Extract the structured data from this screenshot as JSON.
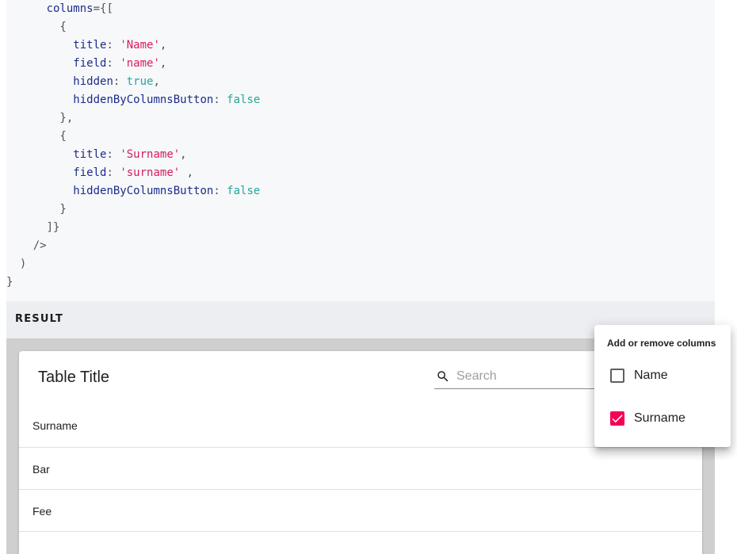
{
  "code": {
    "lines": [
      [
        {
          "t": "      "
        },
        {
          "t": "columns",
          "c": "prop"
        },
        {
          "t": "={[",
          "c": "punc"
        }
      ],
      [
        {
          "t": "        {",
          "c": "punc"
        }
      ],
      [
        {
          "t": "          "
        },
        {
          "t": "title",
          "c": "prop"
        },
        {
          "t": ": ",
          "c": "punc"
        },
        {
          "t": "'Name'",
          "c": "str"
        },
        {
          "t": ",",
          "c": "punc"
        }
      ],
      [
        {
          "t": "          "
        },
        {
          "t": "field",
          "c": "prop"
        },
        {
          "t": ": ",
          "c": "punc"
        },
        {
          "t": "'name'",
          "c": "str"
        },
        {
          "t": ",",
          "c": "punc"
        }
      ],
      [
        {
          "t": "          "
        },
        {
          "t": "hidden",
          "c": "prop"
        },
        {
          "t": ": ",
          "c": "punc"
        },
        {
          "t": "true",
          "c": "bool"
        },
        {
          "t": ",",
          "c": "punc"
        }
      ],
      [
        {
          "t": "          "
        },
        {
          "t": "hiddenByColumnsButton",
          "c": "prop"
        },
        {
          "t": ": ",
          "c": "punc"
        },
        {
          "t": "false",
          "c": "bool"
        }
      ],
      [
        {
          "t": "        },",
          "c": "punc"
        }
      ],
      [
        {
          "t": "        {",
          "c": "punc"
        }
      ],
      [
        {
          "t": "          "
        },
        {
          "t": "title",
          "c": "prop"
        },
        {
          "t": ": ",
          "c": "punc"
        },
        {
          "t": "'Surname'",
          "c": "str"
        },
        {
          "t": ",",
          "c": "punc"
        }
      ],
      [
        {
          "t": "          "
        },
        {
          "t": "field",
          "c": "prop"
        },
        {
          "t": ": ",
          "c": "punc"
        },
        {
          "t": "'surname'",
          "c": "str"
        },
        {
          "t": " ,",
          "c": "punc"
        }
      ],
      [
        {
          "t": "          "
        },
        {
          "t": "hiddenByColumnsButton",
          "c": "prop"
        },
        {
          "t": ": ",
          "c": "punc"
        },
        {
          "t": "false",
          "c": "bool"
        }
      ],
      [
        {
          "t": "        }",
          "c": "punc"
        }
      ],
      [
        {
          "t": "      ]}",
          "c": "punc"
        }
      ],
      [
        {
          "t": "    />",
          "c": "punc"
        }
      ],
      [
        {
          "t": "  )",
          "c": "punc"
        }
      ],
      [
        {
          "t": "}",
          "c": "punc"
        }
      ]
    ]
  },
  "result": {
    "label": "RESULT"
  },
  "table": {
    "title": "Table Title",
    "search": {
      "placeholder": "Search",
      "value": ""
    },
    "columns": [
      "Surname"
    ],
    "rows": [
      [
        "Bar"
      ],
      [
        "Fee"
      ]
    ]
  },
  "column_menu": {
    "header": "Add or remove columns",
    "items": [
      {
        "label": "Name",
        "checked": false
      },
      {
        "label": "Surname",
        "checked": true
      }
    ]
  },
  "colors": {
    "accent": "#f50057",
    "code_property": "#1c2c8a",
    "code_string": "#d81b60",
    "code_boolean": "#26a69a"
  },
  "icons": {
    "search": "search-icon",
    "checkbox_checked": "check-icon"
  }
}
